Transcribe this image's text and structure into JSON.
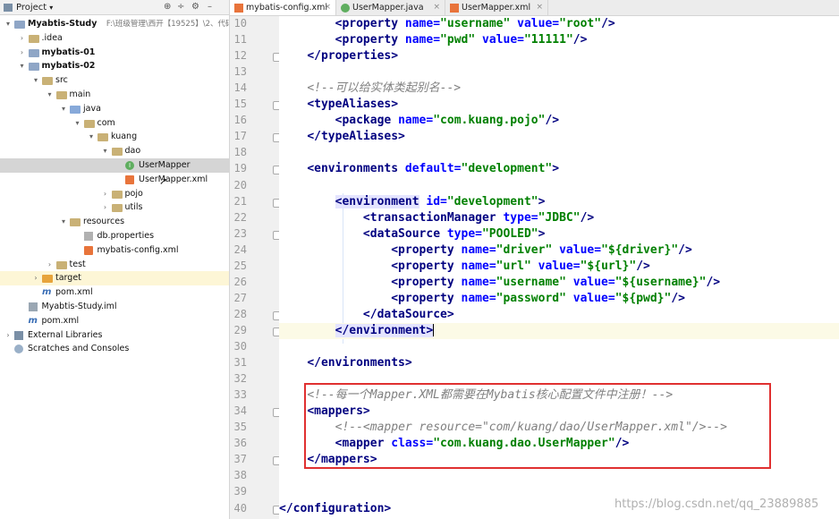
{
  "project_bar": {
    "title": "Project",
    "arrow": "▾",
    "tool_icons": [
      "target-icon",
      "split-icon",
      "gear-icon",
      "hide-icon"
    ]
  },
  "tree": [
    {
      "label": "Myabtis-Study",
      "extra": "F:\\班级管理\\西开【19525】\\2、代码\\My",
      "bold": true,
      "icon": "module-folder-icon",
      "arrow": "▾",
      "depth": 0,
      "state": ""
    },
    {
      "label": ".idea",
      "extra": "",
      "bold": false,
      "icon": "folder-icon",
      "arrow": "›",
      "depth": 1,
      "state": ""
    },
    {
      "label": "mybatis-01",
      "extra": "",
      "bold": true,
      "icon": "module-folder-icon",
      "arrow": "›",
      "depth": 1,
      "state": ""
    },
    {
      "label": "mybatis-02",
      "extra": "",
      "bold": true,
      "icon": "module-folder-icon",
      "arrow": "▾",
      "depth": 1,
      "state": ""
    },
    {
      "label": "src",
      "extra": "",
      "bold": false,
      "icon": "folder-icon",
      "arrow": "▾",
      "depth": 2,
      "state": ""
    },
    {
      "label": "main",
      "extra": "",
      "bold": false,
      "icon": "folder-icon",
      "arrow": "▾",
      "depth": 3,
      "state": ""
    },
    {
      "label": "java",
      "extra": "",
      "bold": false,
      "icon": "source-folder-icon",
      "arrow": "▾",
      "depth": 4,
      "state": ""
    },
    {
      "label": "com",
      "extra": "",
      "bold": false,
      "icon": "package-icon",
      "arrow": "▾",
      "depth": 5,
      "state": ""
    },
    {
      "label": "kuang",
      "extra": "",
      "bold": false,
      "icon": "package-icon",
      "arrow": "▾",
      "depth": 6,
      "state": ""
    },
    {
      "label": "dao",
      "extra": "",
      "bold": false,
      "icon": "package-icon",
      "arrow": "▾",
      "depth": 7,
      "state": ""
    },
    {
      "label": "UserMapper",
      "extra": "",
      "bold": false,
      "icon": "interface-icon",
      "arrow": "",
      "depth": 8,
      "state": "selected"
    },
    {
      "label": "UserMapper.xml",
      "extra": "",
      "bold": false,
      "icon": "xml-file-icon",
      "arrow": "",
      "depth": 8,
      "state": ""
    },
    {
      "label": "pojo",
      "extra": "",
      "bold": false,
      "icon": "package-icon",
      "arrow": "›",
      "depth": 7,
      "state": ""
    },
    {
      "label": "utils",
      "extra": "",
      "bold": false,
      "icon": "package-icon",
      "arrow": "›",
      "depth": 7,
      "state": ""
    },
    {
      "label": "resources",
      "extra": "",
      "bold": false,
      "icon": "resources-folder-icon",
      "arrow": "▾",
      "depth": 4,
      "state": ""
    },
    {
      "label": "db.properties",
      "extra": "",
      "bold": false,
      "icon": "properties-file-icon",
      "arrow": "",
      "depth": 5,
      "state": ""
    },
    {
      "label": "mybatis-config.xml",
      "extra": "",
      "bold": false,
      "icon": "xml-file-icon",
      "arrow": "",
      "depth": 5,
      "state": ""
    },
    {
      "label": "test",
      "extra": "",
      "bold": false,
      "icon": "folder-icon",
      "arrow": "›",
      "depth": 3,
      "state": ""
    },
    {
      "label": "target",
      "extra": "",
      "bold": false,
      "icon": "excluded-folder-icon",
      "arrow": "›",
      "depth": 2,
      "state": "highlight"
    },
    {
      "label": "pom.xml",
      "extra": "",
      "bold": false,
      "icon": "maven-pom-icon",
      "arrow": "",
      "depth": 2,
      "state": ""
    },
    {
      "label": "Myabtis-Study.iml",
      "extra": "",
      "bold": false,
      "icon": "iml-file-icon",
      "arrow": "",
      "depth": 1,
      "state": ""
    },
    {
      "label": "pom.xml",
      "extra": "",
      "bold": false,
      "icon": "maven-pom-icon",
      "arrow": "",
      "depth": 1,
      "state": ""
    },
    {
      "label": "External Libraries",
      "extra": "",
      "bold": false,
      "icon": "library-icon",
      "arrow": "›",
      "depth": 0,
      "state": ""
    },
    {
      "label": "Scratches and Consoles",
      "extra": "",
      "bold": false,
      "icon": "scratches-icon",
      "arrow": "",
      "depth": 0,
      "state": ""
    }
  ],
  "tabs": [
    {
      "label": "mybatis-config.xml",
      "icon": "xml-file-icon",
      "active": true
    },
    {
      "label": "UserMapper.java",
      "icon": "interface-icon",
      "active": false
    },
    {
      "label": "UserMapper.xml",
      "icon": "xml-file-icon",
      "active": false
    }
  ],
  "code": [
    {
      "n": "10",
      "cur": false,
      "seg": [
        [
          "p",
          "        "
        ],
        [
          "t",
          "<property "
        ],
        [
          "a",
          "name="
        ],
        [
          "v",
          "\"username\" "
        ],
        [
          "a",
          "value="
        ],
        [
          "v",
          "\"root\""
        ],
        [
          "t",
          "/>"
        ]
      ]
    },
    {
      "n": "11",
      "cur": false,
      "seg": [
        [
          "p",
          "        "
        ],
        [
          "t",
          "<property "
        ],
        [
          "a",
          "name="
        ],
        [
          "v",
          "\"pwd\" "
        ],
        [
          "a",
          "value="
        ],
        [
          "v",
          "\"11111\""
        ],
        [
          "t",
          "/>"
        ]
      ]
    },
    {
      "n": "12",
      "cur": false,
      "seg": [
        [
          "p",
          "    "
        ],
        [
          "t",
          "</properties>"
        ]
      ]
    },
    {
      "n": "13",
      "cur": false,
      "seg": []
    },
    {
      "n": "14",
      "cur": false,
      "seg": [
        [
          "p",
          "    "
        ],
        [
          "c",
          "<!--可以给实体类起别名-->"
        ]
      ]
    },
    {
      "n": "15",
      "cur": false,
      "seg": [
        [
          "p",
          "    "
        ],
        [
          "t",
          "<typeAliases>"
        ]
      ]
    },
    {
      "n": "16",
      "cur": false,
      "seg": [
        [
          "p",
          "        "
        ],
        [
          "t",
          "<package "
        ],
        [
          "a",
          "name="
        ],
        [
          "v",
          "\"com.kuang.pojo\""
        ],
        [
          "t",
          "/>"
        ]
      ]
    },
    {
      "n": "17",
      "cur": false,
      "seg": [
        [
          "p",
          "    "
        ],
        [
          "t",
          "</typeAliases>"
        ]
      ]
    },
    {
      "n": "18",
      "cur": false,
      "seg": []
    },
    {
      "n": "19",
      "cur": false,
      "seg": [
        [
          "p",
          "    "
        ],
        [
          "t",
          "<environments "
        ],
        [
          "a",
          "default="
        ],
        [
          "v",
          "\"development\""
        ],
        [
          "t",
          ">"
        ]
      ]
    },
    {
      "n": "20",
      "cur": false,
      "seg": []
    },
    {
      "n": "21",
      "cur": false,
      "seg": [
        [
          "p",
          "        "
        ],
        [
          "th",
          "<environment"
        ],
        [
          "p",
          " "
        ],
        [
          "a",
          "id="
        ],
        [
          "v",
          "\"development\""
        ],
        [
          "t",
          ">"
        ]
      ]
    },
    {
      "n": "22",
      "cur": false,
      "seg": [
        [
          "p",
          "            "
        ],
        [
          "t",
          "<transactionManager "
        ],
        [
          "a",
          "type="
        ],
        [
          "v",
          "\"JDBC\""
        ],
        [
          "t",
          "/>"
        ]
      ]
    },
    {
      "n": "23",
      "cur": false,
      "seg": [
        [
          "p",
          "            "
        ],
        [
          "t",
          "<dataSource "
        ],
        [
          "a",
          "type="
        ],
        [
          "v",
          "\"POOLED\""
        ],
        [
          "t",
          ">"
        ]
      ]
    },
    {
      "n": "24",
      "cur": false,
      "seg": [
        [
          "p",
          "                "
        ],
        [
          "t",
          "<property "
        ],
        [
          "a",
          "name="
        ],
        [
          "v",
          "\"driver\" "
        ],
        [
          "a",
          "value="
        ],
        [
          "v",
          "\"${driver}\""
        ],
        [
          "t",
          "/>"
        ]
      ]
    },
    {
      "n": "25",
      "cur": false,
      "seg": [
        [
          "p",
          "                "
        ],
        [
          "t",
          "<property "
        ],
        [
          "a",
          "name="
        ],
        [
          "v",
          "\"url\" "
        ],
        [
          "a",
          "value="
        ],
        [
          "v",
          "\"${url}\""
        ],
        [
          "t",
          "/>"
        ]
      ]
    },
    {
      "n": "26",
      "cur": false,
      "seg": [
        [
          "p",
          "                "
        ],
        [
          "t",
          "<property "
        ],
        [
          "a",
          "name="
        ],
        [
          "v",
          "\"username\" "
        ],
        [
          "a",
          "value="
        ],
        [
          "v",
          "\"${username}\""
        ],
        [
          "t",
          "/>"
        ]
      ]
    },
    {
      "n": "27",
      "cur": false,
      "seg": [
        [
          "p",
          "                "
        ],
        [
          "t",
          "<property "
        ],
        [
          "a",
          "name="
        ],
        [
          "v",
          "\"password\" "
        ],
        [
          "a",
          "value="
        ],
        [
          "v",
          "\"${pwd}\""
        ],
        [
          "t",
          "/>"
        ]
      ]
    },
    {
      "n": "28",
      "cur": false,
      "seg": [
        [
          "p",
          "            "
        ],
        [
          "t",
          "</dataSource>"
        ]
      ]
    },
    {
      "n": "29",
      "cur": true,
      "seg": [
        [
          "p",
          "        "
        ],
        [
          "th",
          "</environment>"
        ],
        [
          "cursor",
          ""
        ]
      ]
    },
    {
      "n": "30",
      "cur": false,
      "seg": []
    },
    {
      "n": "31",
      "cur": false,
      "seg": [
        [
          "p",
          "    "
        ],
        [
          "t",
          "</environments>"
        ]
      ]
    },
    {
      "n": "32",
      "cur": false,
      "seg": []
    },
    {
      "n": "33",
      "cur": false,
      "seg": [
        [
          "p",
          "    "
        ],
        [
          "c",
          "<!--每一个Mapper.XML都需要在Mybatis核心配置文件中注册！-->"
        ]
      ]
    },
    {
      "n": "34",
      "cur": false,
      "seg": [
        [
          "p",
          "    "
        ],
        [
          "t",
          "<mappers>"
        ]
      ]
    },
    {
      "n": "35",
      "cur": false,
      "seg": [
        [
          "p",
          "        "
        ],
        [
          "c",
          "<!--<mapper resource=\"com/kuang/dao/UserMapper.xml\"/>-->"
        ]
      ]
    },
    {
      "n": "36",
      "cur": false,
      "seg": [
        [
          "p",
          "        "
        ],
        [
          "t",
          "<mapper "
        ],
        [
          "a",
          "class="
        ],
        [
          "v",
          "\"com.kuang.dao.UserMapper\""
        ],
        [
          "t",
          "/>"
        ]
      ]
    },
    {
      "n": "37",
      "cur": false,
      "seg": [
        [
          "p",
          "    "
        ],
        [
          "t",
          "</mappers>"
        ]
      ]
    },
    {
      "n": "38",
      "cur": false,
      "seg": []
    },
    {
      "n": "39",
      "cur": false,
      "seg": []
    },
    {
      "n": "40",
      "cur": false,
      "seg": [
        [
          "t",
          "</configuration>"
        ]
      ]
    }
  ],
  "watermark": "https://blog.csdn.net/qq_23889885"
}
